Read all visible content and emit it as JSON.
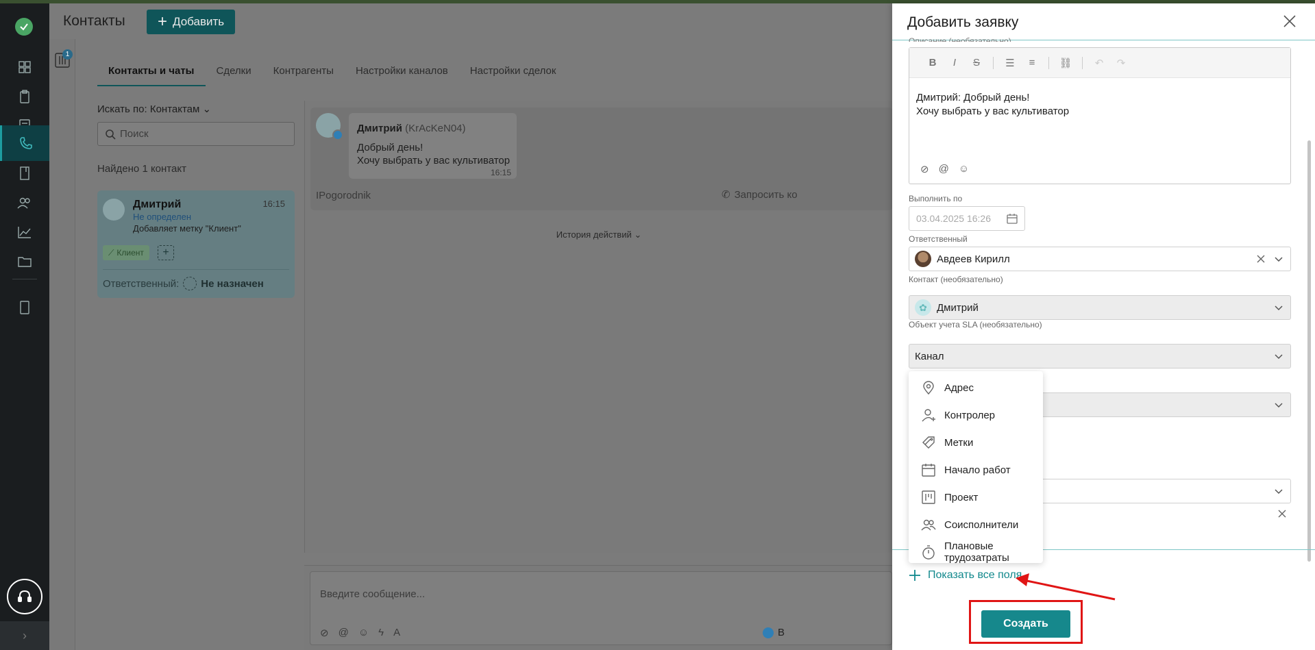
{
  "app": {
    "title": "Контакты",
    "add_label": "Добавить",
    "filter_badge": "1"
  },
  "tabs": [
    "Контакты и чаты",
    "Сделки",
    "Контрагенты",
    "Настройки каналов",
    "Настройки сделок"
  ],
  "search": {
    "by": "Искать по: Контактам",
    "placeholder": "Поиск",
    "found": "Найдено 1 контакт"
  },
  "contact": {
    "name": "Дмитрий",
    "time": "16:15",
    "status": "Не определен",
    "desc": "Добавляет метку \"Клиент\"",
    "tag": "Клиент",
    "responsible_label": "Ответственный:",
    "responsible_value": "Не назначен"
  },
  "chat": {
    "sender": "Дмитрий",
    "handle": "(KrAcKeN04)",
    "line1": "Добрый день!",
    "line2": "Хочу выбрать у вас культиватор",
    "time": "16:15",
    "source": "IPogorodnik",
    "request": "Запросить ко",
    "history": "История действий",
    "composer_placeholder": "Введите сообщение...",
    "send_label": "В"
  },
  "panel": {
    "title": "Добавить заявку",
    "desc_label_cut": "Описание (необязательно)",
    "editor_line1": "Дмитрий: Добрый день!",
    "editor_line2": "Хочу выбрать у вас культиватор",
    "due_label": "Выполнить по",
    "due_value": "03.04.2025 16:26",
    "responsible_label": "Ответственный",
    "responsible_value": "Авдеев Кирилл",
    "contact_label": "Контакт (необязательно)",
    "contact_value": "Дмитрий",
    "sla_label": "Объект учета SLA (необязательно)",
    "sla_value": "Канал",
    "show_all": "Показать все поля",
    "create": "Создать"
  },
  "dropdown": [
    {
      "label": "Адрес",
      "icon": "location-icon"
    },
    {
      "label": "Контролер",
      "icon": "user-add-icon"
    },
    {
      "label": "Метки",
      "icon": "tags-icon"
    },
    {
      "label": "Начало работ",
      "icon": "calendar-icon"
    },
    {
      "label": "Проект",
      "icon": "project-board-icon"
    },
    {
      "label": "Соисполнители",
      "icon": "users-icon"
    },
    {
      "label": "Плановые трудозатраты",
      "icon": "stopwatch-icon"
    }
  ],
  "colors": {
    "accent": "#16888c",
    "highlight": "#e01515"
  }
}
